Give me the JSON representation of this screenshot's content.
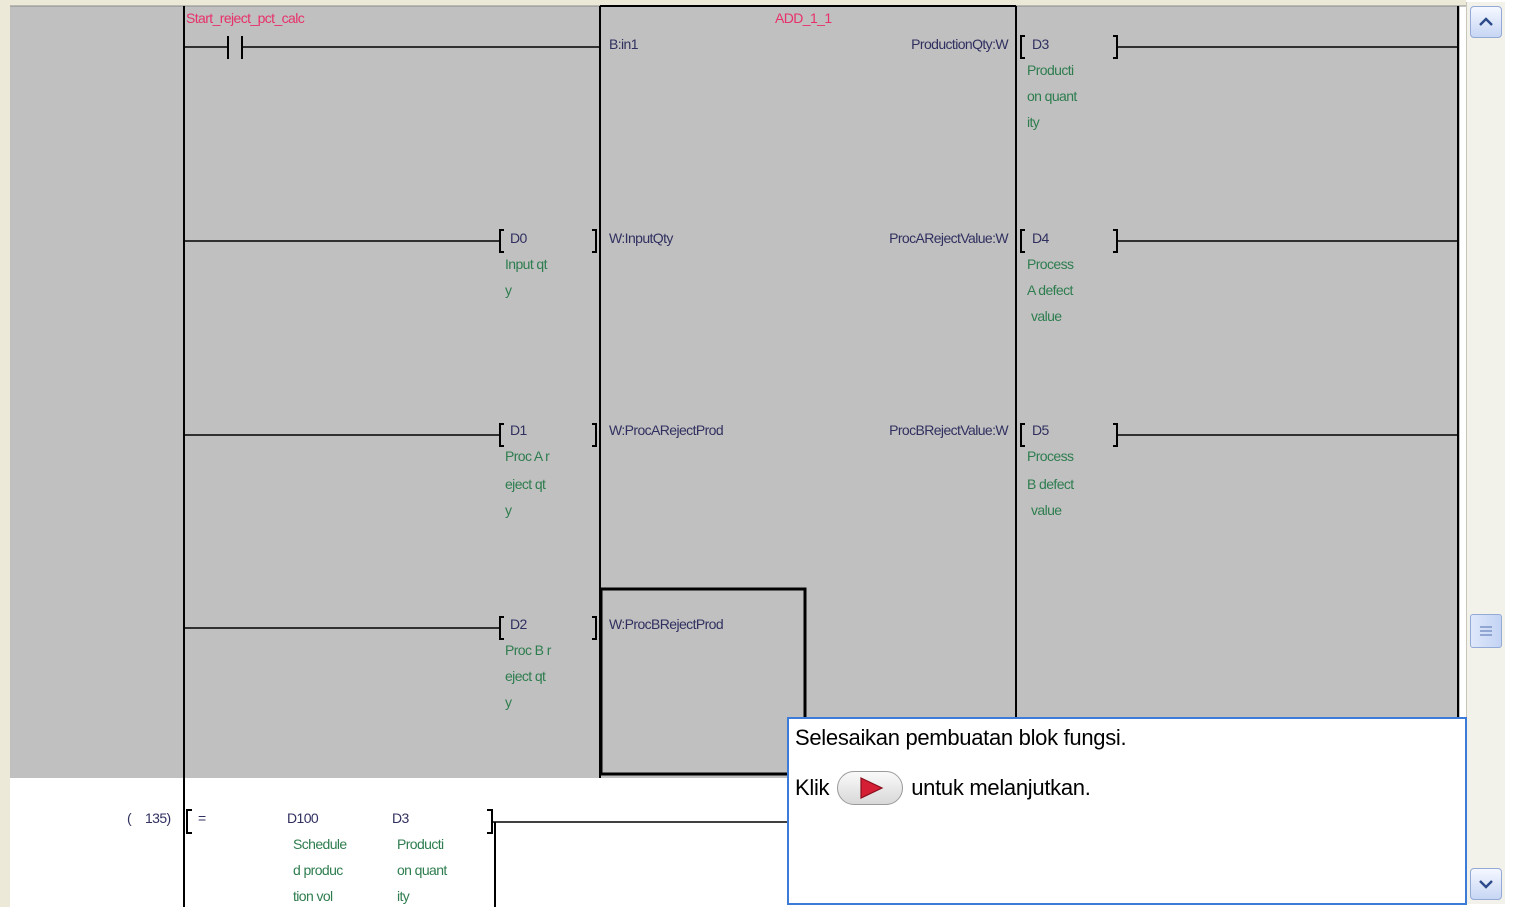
{
  "rung1": {
    "contact_label": "Start_reject_pct_calc",
    "fb_name": "ADD_1_1",
    "inputs": [
      {
        "device": "",
        "comment": [],
        "pin": "B:in1"
      },
      {
        "device": "D0",
        "comment": [
          "Input qt",
          "y"
        ],
        "pin": "W:InputQty"
      },
      {
        "device": "D1",
        "comment": [
          "Proc A r",
          "eject qt",
          "y"
        ],
        "pin": "W:ProcARejectProd"
      },
      {
        "device": "D2",
        "comment": [
          "Proc B r",
          "eject qt",
          "y"
        ],
        "pin": "W:ProcBRejectProd"
      }
    ],
    "outputs": [
      {
        "pin": "ProductionQty:W",
        "device": "D3",
        "comment": [
          "Producti",
          "on quant",
          "ity"
        ]
      },
      {
        "pin": "ProcARejectValue:W",
        "device": "D4",
        "comment": [
          "Process",
          "A defect",
          "value"
        ]
      },
      {
        "pin": "ProcBRejectValue:W",
        "device": "D5",
        "comment": [
          "Process",
          "B defect",
          "value"
        ]
      }
    ]
  },
  "rung2": {
    "step_open": "(",
    "step": "135)",
    "instruction": "=",
    "operand1": {
      "device": "D100",
      "comment": [
        "Schedule",
        "d produc",
        "tion vol"
      ]
    },
    "operand2": {
      "device": "D3",
      "comment": [
        "Producti",
        "on quant",
        "ity"
      ]
    }
  },
  "tooltip": {
    "line1": "Selesaikan pembuatan blok fungsi.",
    "prefix": "Klik",
    "suffix": "untuk melanjutkan.",
    "next_icon": "play-arrow-icon"
  },
  "scrollbar": {
    "up_icon": "chevron-up-icon",
    "down_icon": "chevron-down-icon",
    "thumb_icon": "grip-icon"
  },
  "colors": {
    "rung_background": "#c0c0c0",
    "canvas_background": "#ffffff",
    "device_text": "#303060",
    "comment_text": "#2e7d4f",
    "label_text": "#e8306a",
    "tooltip_border": "#3d7bd9"
  }
}
